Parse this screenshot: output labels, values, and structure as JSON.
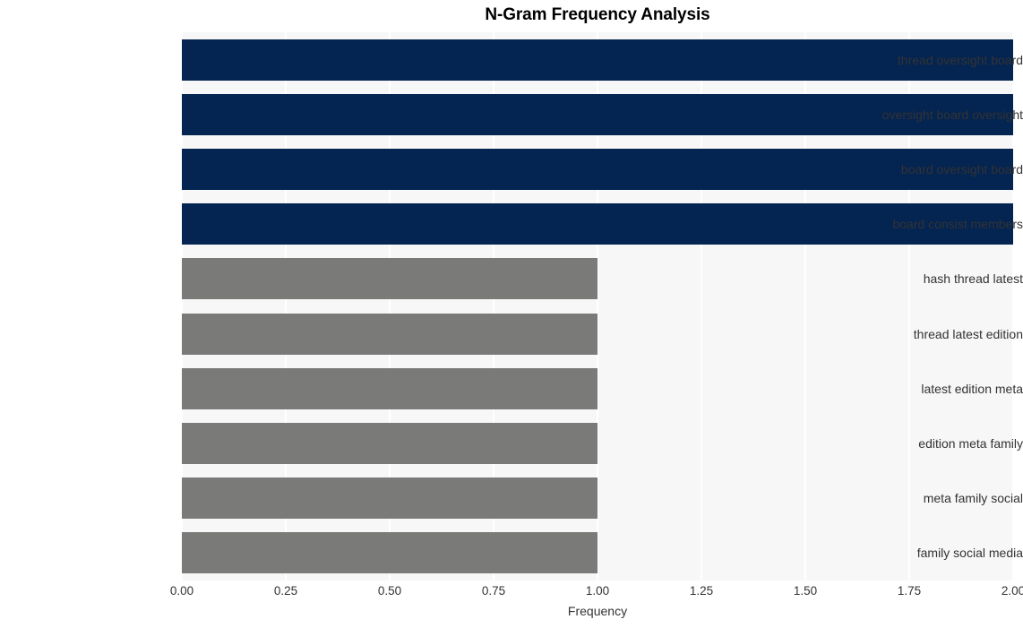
{
  "chart_data": {
    "type": "bar",
    "orientation": "horizontal",
    "title": "N-Gram Frequency Analysis",
    "xlabel": "Frequency",
    "ylabel": "",
    "categories": [
      "thread oversight board",
      "oversight board oversight",
      "board oversight board",
      "board consist members",
      "hash thread latest",
      "thread latest edition",
      "latest edition meta",
      "edition meta family",
      "meta family social",
      "family social media"
    ],
    "values": [
      2,
      2,
      2,
      2,
      1,
      1,
      1,
      1,
      1,
      1
    ],
    "bar_colors": [
      "#042451",
      "#042451",
      "#042451",
      "#042451",
      "#7a7a78",
      "#7a7a78",
      "#7a7a78",
      "#7a7a78",
      "#7a7a78",
      "#7a7a78"
    ],
    "xlim": [
      0,
      2
    ],
    "xticks": [
      0,
      0.25,
      0.5,
      0.75,
      1,
      1.25,
      1.5,
      1.75,
      2
    ],
    "xtick_labels": [
      "0.00",
      "0.25",
      "0.50",
      "0.75",
      "1.00",
      "1.25",
      "1.50",
      "1.75",
      "2.00"
    ],
    "grid": true,
    "grid_axis": "x",
    "grid_color": "#ffffff",
    "plot_background": "#f7f7f7",
    "figure_background": "#ffffff",
    "legend": null,
    "annotations": []
  }
}
